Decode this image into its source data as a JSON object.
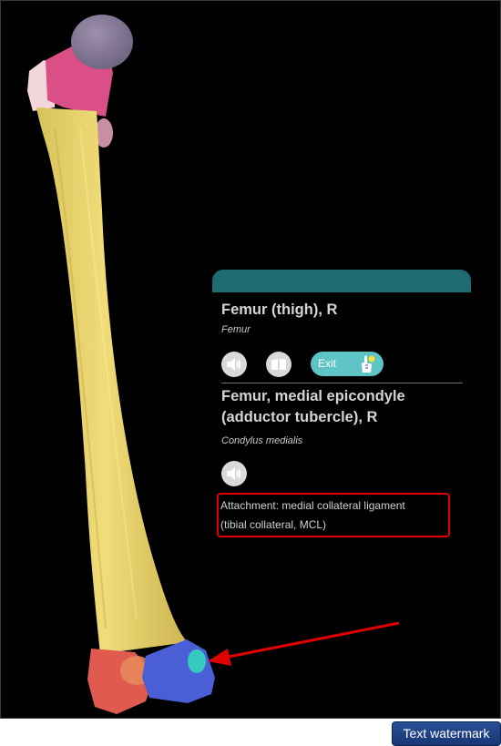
{
  "info_panel": {
    "structure_title": "Femur (thigh), R",
    "structure_latin": "Femur",
    "exit_label": "Exit",
    "detail_title_line1": "Femur, medial epicondyle",
    "detail_title_line2": "(adductor tubercle), R",
    "detail_latin": "Condylus medialis",
    "attachment_line1": "Attachment: medial collateral ligament",
    "attachment_line2": "(tibial collateral, MCL)"
  },
  "icons": {
    "speaker": "speaker-icon",
    "book": "book-icon",
    "hand": "hand-pointer-icon",
    "arrow": "red-arrow"
  },
  "colors": {
    "header_teal": "#1f6b72",
    "exit_button": "#5fc4c6",
    "highlight_box": "#e00000",
    "bone_shaft": "#e9d36b",
    "femoral_head": "#8a7d98",
    "neck": "#d94f86",
    "lateral_condyle": "#e05a50",
    "medial_condyle": "#4a5fd6",
    "medial_epicondyle": "#36c9bf"
  },
  "watermark": "Text watermark"
}
